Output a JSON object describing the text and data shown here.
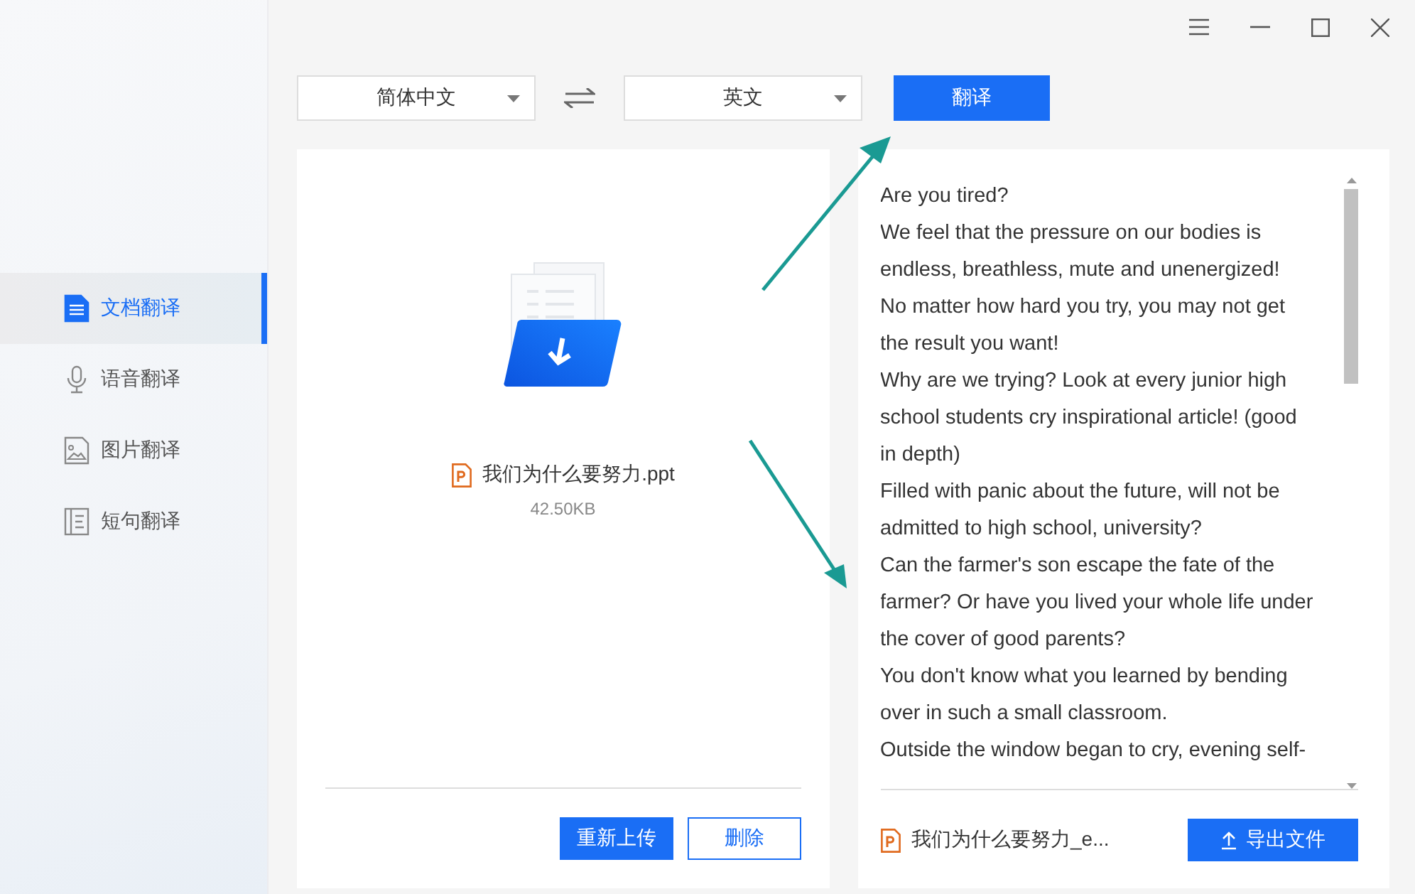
{
  "sidebar": {
    "items": [
      {
        "label": "文档翻译",
        "selected": true
      },
      {
        "label": "语音翻译",
        "selected": false
      },
      {
        "label": "图片翻译",
        "selected": false
      },
      {
        "label": "短句翻译",
        "selected": false
      }
    ]
  },
  "toolbar": {
    "source_language": "简体中文",
    "target_language": "英文",
    "translate_button": "翻译"
  },
  "source_panel": {
    "file_name": "我们为什么要努力.ppt",
    "file_size": "42.50KB",
    "buttons": [
      "重新上传",
      "删除"
    ]
  },
  "result_panel": {
    "lines": [
      "Are you tired?",
      "We feel that the pressure on our bodies is",
      "endless, breathless, mute and unenergized!",
      "No matter how hard you try, you may not get",
      "the result you want!",
      "Why are we trying? Look at every junior high",
      "school students cry inspirational article! (good",
      "in depth)",
      "Filled with panic about the future, will not be",
      "admitted to high school, university?",
      "Can the farmer's son escape the fate of the",
      "farmer? Or have you lived your whole life under",
      "the cover of good parents?",
      "You don't know what you learned by bending",
      "over in such a small classroom.",
      "Outside the window began to cry, evening self-"
    ],
    "file_name": "我们为什么要努力_e...",
    "export_button": "导出文件"
  }
}
